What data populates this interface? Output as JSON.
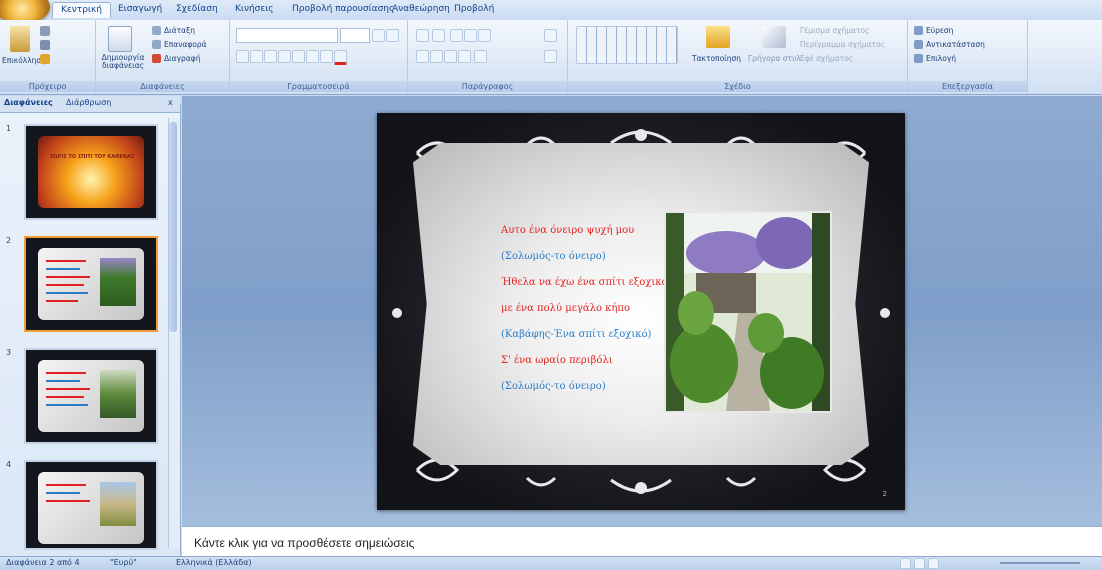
{
  "ribbon": {
    "tabs": [
      "Κεντρική",
      "Εισαγωγή",
      "Σχεδίαση",
      "Κινήσεις",
      "Προβολή παρουσίασης",
      "Αναθεώρηση",
      "Προβολή"
    ],
    "groups": {
      "clipboard": {
        "label": "Πρόχειρο",
        "paste": "Επικόλληση"
      },
      "slides": {
        "label": "Διαφάνειες",
        "new_slide": "Δημιουργία διαφάνειας",
        "layout": "Διάταξη",
        "reset": "Επαναφορά",
        "delete": "Διαγραφή"
      },
      "font": {
        "label": "Γραμματοσειρά"
      },
      "paragraph": {
        "label": "Παράγραφος"
      },
      "drawing": {
        "label": "Σχέδιο",
        "arrange": "Τακτοποίηση",
        "quick_styles": "Γρήγορα στυλ",
        "fill": "Γέμισμα σχήματος",
        "outline": "Περίγραμμα σχήματος",
        "effects": "Εφέ σχήματος"
      },
      "editing": {
        "label": "Επεξεργασία",
        "find": "Εύρεση",
        "replace": "Αντικατάσταση",
        "select": "Επιλογή"
      }
    }
  },
  "slides_pane": {
    "tabs": [
      "Διαφάνειες",
      "Διάρθρωση"
    ],
    "close": "x",
    "thumbnails": [
      {
        "num": "1",
        "title": "ΧΩΡΙΣ ΤΟ ΣΠΙΤΙ ΤΟΥ ΚΑΘΕΝΑΣ"
      },
      {
        "num": "2"
      },
      {
        "num": "3"
      },
      {
        "num": "4"
      }
    ]
  },
  "slide": {
    "lines": [
      {
        "text": "Αυτο ένα όνειρο ψυχή μου",
        "color": "#e0221f"
      },
      {
        "text": "(Σολωμός-το όνειρο)",
        "color": "#2a7cc6"
      },
      {
        "text": "Ήθελα να έχω ένα σπίτι εξοχικό",
        "color": "#e0221f"
      },
      {
        "text": "με ένα πολύ μεγάλο κήπο",
        "color": "#e0221f"
      },
      {
        "text": "(Καβάφης-Ένα σπίτι εξοχικό)",
        "color": "#2a7cc6"
      },
      {
        "text": "Σ' ένα ωραίο περιβόλι",
        "color": "#e0221f"
      },
      {
        "text": "(Σολωμός-το όνειρο)",
        "color": "#2a7cc6"
      }
    ],
    "number": "2"
  },
  "notes_placeholder": "Κάντε κλικ για να προσθέσετε σημειώσεις",
  "status": {
    "slide": "Διαφάνεια 2 από 4",
    "theme": "\"Ευρύ\"",
    "lang": "Ελληνικά (Ελλάδα)"
  }
}
